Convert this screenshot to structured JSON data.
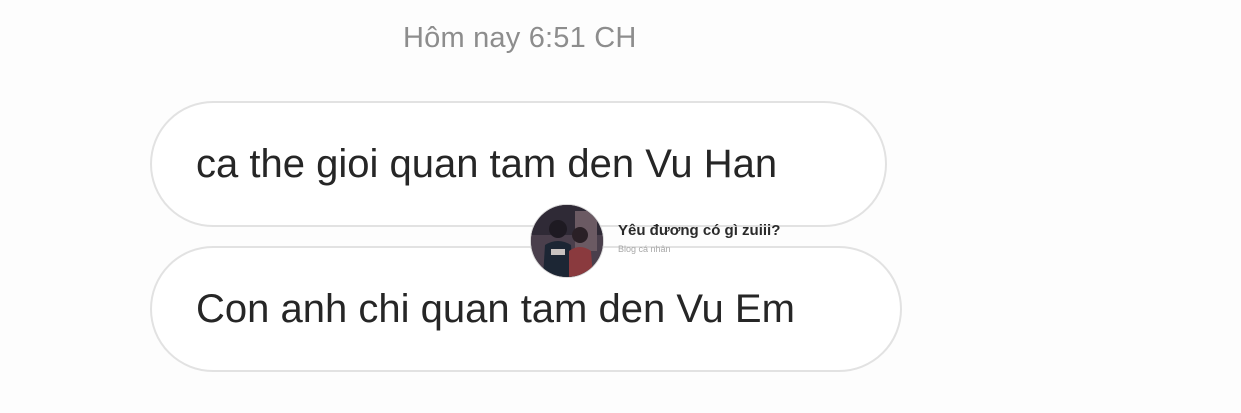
{
  "timestamp": "Hôm nay 6:51 CH",
  "messages": [
    {
      "text": "ca the gioi quan tam den Vu Han"
    },
    {
      "text": "Con anh chi quan tam den Vu Em"
    }
  ],
  "overlay": {
    "name": "Yêu đương có gì zuiii?",
    "subtitle": "Blog cá nhân",
    "avatar_icon": "profile-photo"
  },
  "colors": {
    "background": "#fdfdfd",
    "bubble_border": "#e2e2e2",
    "timestamp_text": "#8d8d8d",
    "message_text": "#262626"
  }
}
